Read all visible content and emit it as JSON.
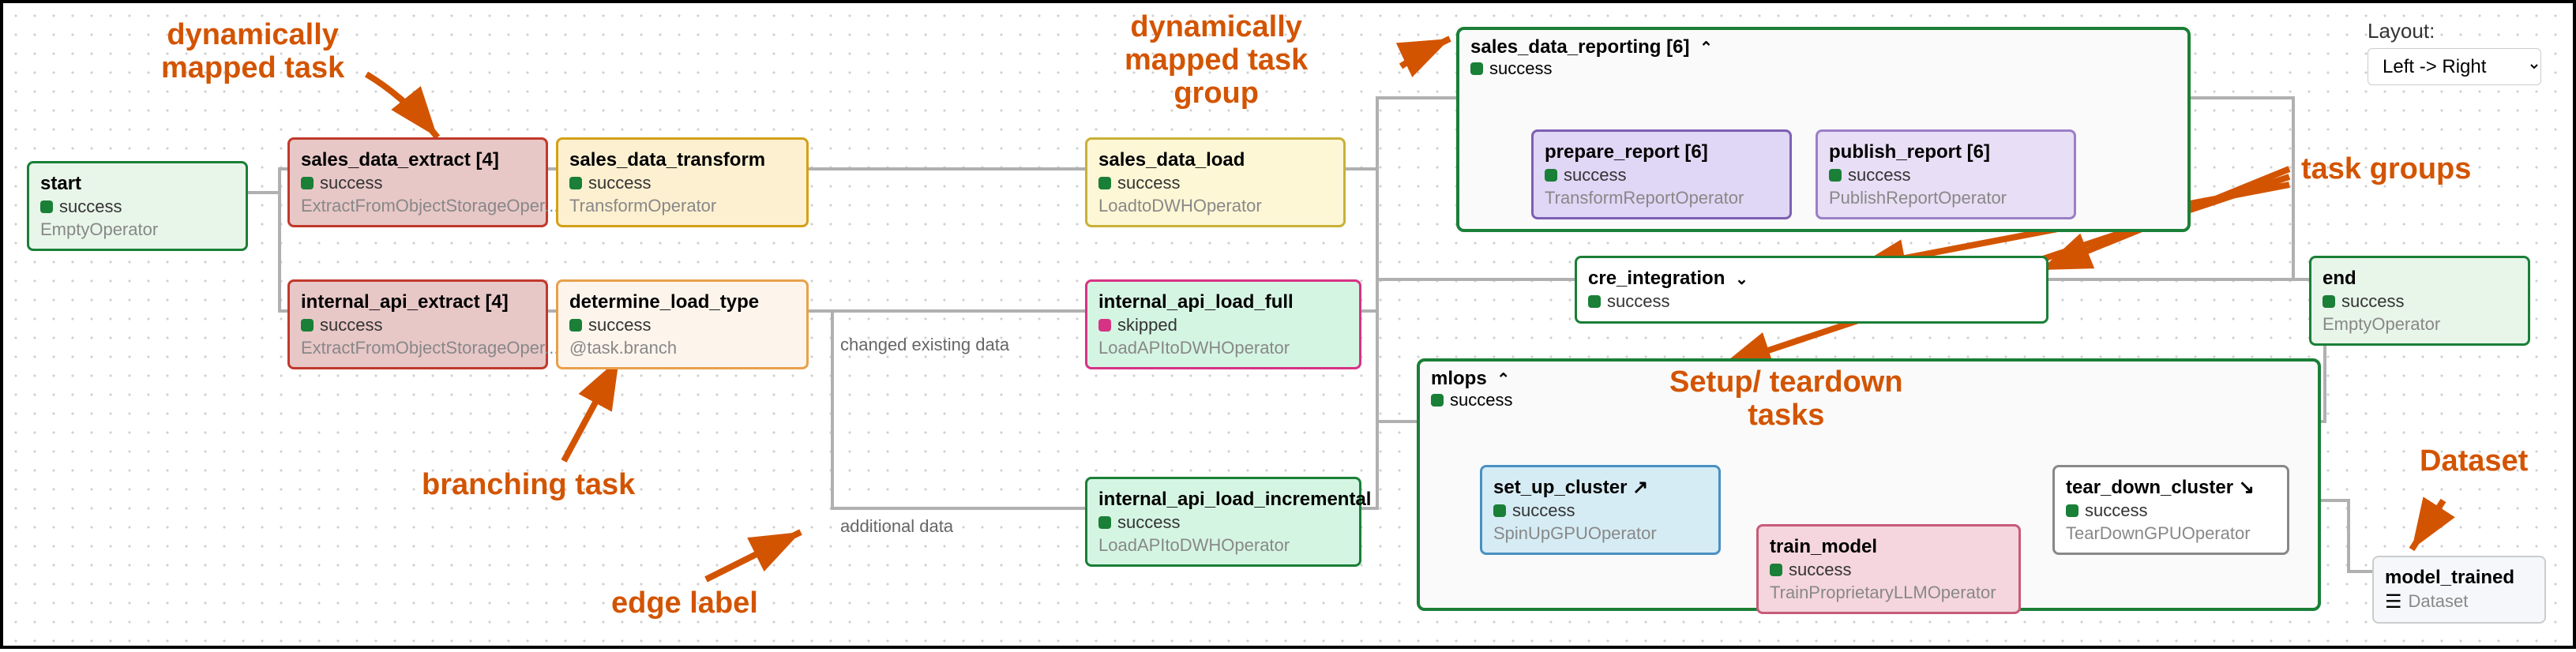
{
  "layout": {
    "label": "Layout:",
    "value": "Left -> Right"
  },
  "status": {
    "success": "success",
    "skipped": "skipped"
  },
  "annotations": {
    "dyn_task": "dynamically\nmapped task",
    "dyn_group": "dynamically\nmapped task\ngroup",
    "task_groups": "task groups",
    "branching": "branching task",
    "edge_label": "edge label",
    "setup_teardown": "Setup/ teardown\ntasks",
    "dataset": "Dataset"
  },
  "edge_labels": {
    "changed": "changed existing data",
    "additional": "additional data"
  },
  "nodes": {
    "start": {
      "title": "start",
      "op": "EmptyOperator"
    },
    "sales_extract": {
      "title": "sales_data_extract [4]",
      "op": "ExtractFromObjectStorageOper..."
    },
    "internal_extract": {
      "title": "internal_api_extract [4]",
      "op": "ExtractFromObjectStorageOper..."
    },
    "sales_transform": {
      "title": "sales_data_transform",
      "op": "TransformOperator"
    },
    "determine": {
      "title": "determine_load_type",
      "op": "@task.branch"
    },
    "sales_load": {
      "title": "sales_data_load",
      "op": "LoadtoDWHOperator"
    },
    "api_full": {
      "title": "internal_api_load_full",
      "op": "LoadAPItoDWHOperator"
    },
    "api_inc": {
      "title": "internal_api_load_incremental",
      "op": "LoadAPItoDWHOperator"
    },
    "prepare": {
      "title": "prepare_report [6]",
      "op": "TransformReportOperator"
    },
    "publish": {
      "title": "publish_report [6]",
      "op": "PublishReportOperator"
    },
    "cre": {
      "title": "cre_integration"
    },
    "setup": {
      "title": "set_up_cluster ↗",
      "op": "SpinUpGPUOperator"
    },
    "train": {
      "title": "train_model",
      "op": "TrainProprietaryLLMOperator"
    },
    "tear": {
      "title": "tear_down_cluster ↘",
      "op": "TearDownGPUOperator"
    },
    "end": {
      "title": "end",
      "op": "EmptyOperator"
    },
    "dataset": {
      "title": "model_trained",
      "op": "Dataset"
    }
  },
  "groups": {
    "reporting": {
      "title": "sales_data_reporting [6]",
      "icon": "⌃"
    },
    "mlops": {
      "title": "mlops",
      "icon": "⌃"
    }
  }
}
